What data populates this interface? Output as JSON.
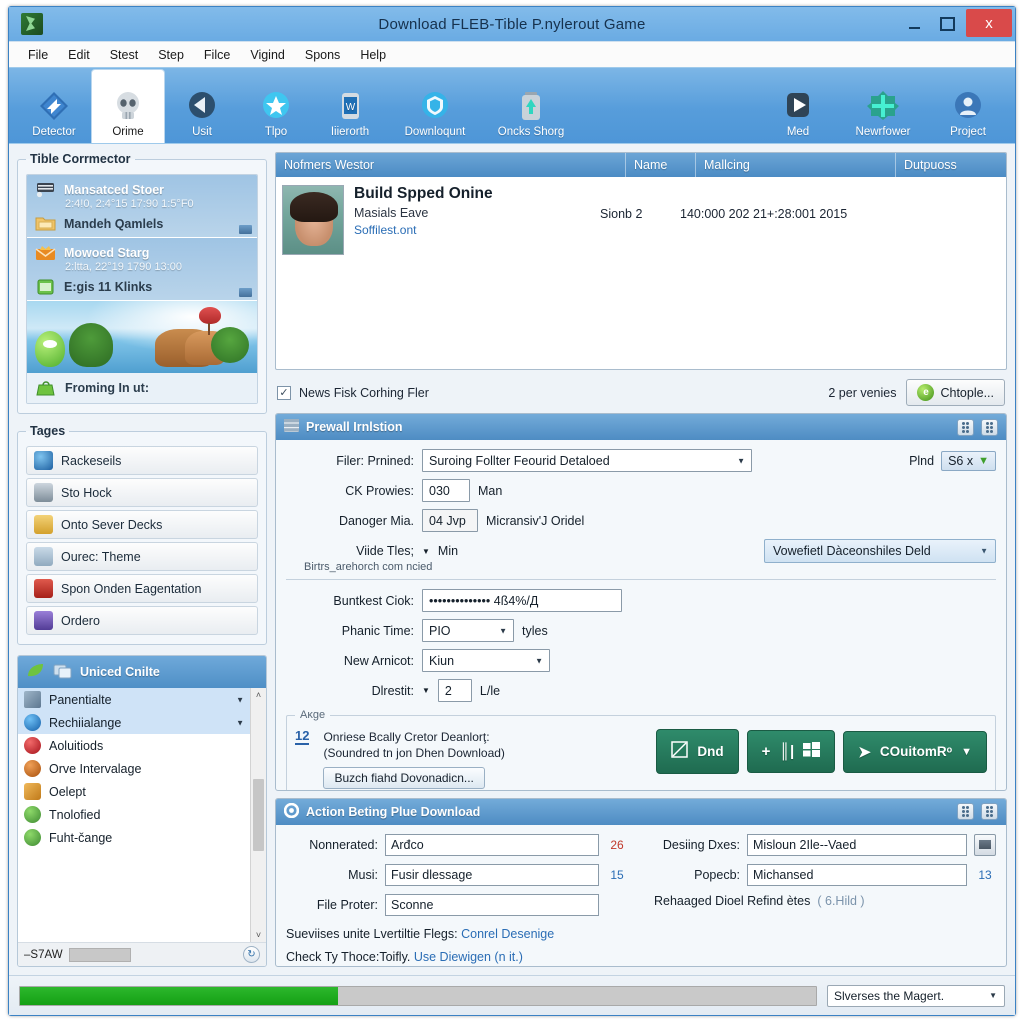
{
  "window": {
    "title": "Download FLEB-Tible P.nylerout Game",
    "icon": "app-icon",
    "controls": {
      "minimize": "–",
      "maximize": "□",
      "close": "x"
    }
  },
  "menubar": {
    "items": [
      "File",
      "Edit",
      "Stest",
      "Step",
      "Filce",
      "Vigind",
      "Spons",
      "Help"
    ]
  },
  "toolbar": {
    "items": [
      {
        "label": "Detector",
        "icon": "diamond-arrow-icon",
        "active": false
      },
      {
        "label": "Orime",
        "icon": "skull-icon",
        "active": true
      },
      {
        "label": "Usit",
        "icon": "back-arrow-icon",
        "active": false
      },
      {
        "label": "Tlpo",
        "icon": "star-circle-icon",
        "active": false
      },
      {
        "label": "Iiierorth",
        "icon": "phone-icon",
        "active": false
      },
      {
        "label": "Downloqunt",
        "icon": "shield-icon",
        "active": false
      },
      {
        "label": "Oncks Shorg",
        "icon": "battery-down-icon",
        "active": false
      }
    ],
    "right_items": [
      {
        "label": "Med",
        "icon": "play-icon"
      },
      {
        "label": "Newrfower",
        "icon": "plus-burst-icon"
      },
      {
        "label": "Project",
        "icon": "person-gear-icon"
      }
    ]
  },
  "sidebar": {
    "connector": {
      "legend": "Tible Corrmector",
      "rows": [
        {
          "title": "Mansatced Stoer",
          "sub": "2:4!0, 2:4°15 17:90 1:5°F0",
          "title2": "Mandeh Qamlels",
          "icon": "printer-icon",
          "icon2": "folder-icon"
        },
        {
          "title": "Mowoed Starg",
          "sub": "2:ltta, 22°19 1790 13:00",
          "title2": "E:gis 11 Klinks",
          "icon": "crown-mail-icon",
          "icon2": "green-note-icon"
        }
      ],
      "banner": "landscape-banner",
      "footer": {
        "label": "Froming In ut:",
        "icon": "green-bag-icon"
      }
    },
    "tags": {
      "legend": "Tages",
      "items": [
        {
          "label": "Rackeseils",
          "icon": "globe-icon",
          "color": "#2f7cc4"
        },
        {
          "label": "Sto Hock",
          "icon": "disk-icon",
          "color": "#7d8b99"
        },
        {
          "label": "Onto Sever Decks",
          "icon": "people-icon",
          "color": "#e0b03c"
        },
        {
          "label": "Ourec: Theme",
          "icon": "image-icon",
          "color": "#9bb4c7"
        },
        {
          "label": "Spon Onden Eagentation",
          "icon": "red-doc-icon",
          "color": "#c0302b"
        },
        {
          "label": "Ordero",
          "icon": "purple-doc-icon",
          "color": "#6b4fb0"
        }
      ]
    },
    "explorer": {
      "title": "Uniced Cnilte",
      "head_icons": [
        "leaf-icon",
        "window-icon"
      ],
      "items": [
        {
          "label": "Panentialte",
          "icon": "grid-icon",
          "color": "#6d8ba5",
          "selected": true
        },
        {
          "label": "Rechiialange",
          "icon": "plus-circle-icon",
          "color": "#1f7fd0",
          "selected": true
        },
        {
          "label": "Aoluitiods",
          "icon": "target-icon",
          "color": "#cf2430",
          "selected": false
        },
        {
          "label": "Orve Intervalage",
          "icon": "donut-icon",
          "color": "#cf6a18",
          "selected": false
        },
        {
          "label": "Oelept",
          "icon": "key-icon",
          "color": "#d98b2c",
          "selected": false
        },
        {
          "label": "Tnolofied",
          "icon": "gear-green-icon",
          "color": "#4a9a4a",
          "selected": false
        },
        {
          "label": "Fuht-čange",
          "icon": "gear-green-icon",
          "color": "#4a9a4a",
          "selected": false
        }
      ],
      "footer": {
        "label": "–S7AW",
        "refresh_icon": "refresh-icon"
      },
      "scroll": {
        "up": "˄",
        "down": "˅"
      }
    }
  },
  "grid": {
    "columns": [
      "Nofmers Westor",
      "Name",
      "Mallcing",
      "Dutpuoss"
    ],
    "rows": [
      {
        "thumb": "person-photo",
        "title": "Build Spped Onine",
        "sub": "Masials Eave",
        "link": "Soffilest.ont",
        "name": "Sionb 2",
        "mallcing": "140:000 202 21+:28:001 2015",
        "dutpuoss": ""
      }
    ],
    "footer": {
      "checkbox_label": "News Fisk Corhing Fler",
      "checkbox_checked": true,
      "count": "2",
      "count_suffix": "per venies",
      "button": "Chtople...",
      "button_icon": "green-orb-icon"
    }
  },
  "panel_firewall": {
    "title": "Prewall Irnlstion",
    "icon": "firewall-icon",
    "header_buttons": [
      "grip-button-1",
      "grip-button-2"
    ],
    "fields": {
      "filer_label": "Filer: Prnined:",
      "filer_value": "Suroing Follter Feourid Detaloed",
      "pind_label": "Plnd",
      "pind_value": "S6 x",
      "ck_label": "CK Prowies:",
      "ck_value": "030",
      "ck_suffix": "Man",
      "danger_label": "Danoger Mia.",
      "danger_value": "04 Jvp",
      "danger_suffix": "Micransiv'J Oridel",
      "viide_label": "Viide Tles;",
      "viide_value": "Min",
      "viide_note": "Birtrs_arehorch com ncied",
      "novel_select": "Vowefietl Dàceonshiles Deld",
      "bunt_label": "Buntkest Ciok:",
      "bunt_value": "••••••••••••••   4ß4%/Д",
      "phanic_label": "Phanic Time:",
      "phanic_value": "PIO",
      "phanic_suffix": "tyles",
      "amicot_label": "New Arnicot:",
      "amicot_value": "Kiun",
      "direstit_label": "Dlrestit:",
      "direstit_value": "2",
      "direstit_suffix": "L/le"
    },
    "area": {
      "legend": "Aĸge",
      "badge": "12",
      "text_line1": "Onriese Bcally Cretor Deanlorţ:",
      "text_line2": "(Soundred tn jon Dhen Download)",
      "button": "Buzch fiahd Dovonadicn...",
      "green_buttons": [
        {
          "label": "Dnd",
          "icon": "edit-doc-icon"
        },
        {
          "label": "",
          "icon": "plus-bars-grid-icon"
        },
        {
          "label": "COuitomRᵒ",
          "icon": "send-icon",
          "caret": "▼"
        }
      ]
    }
  },
  "panel_action": {
    "title": "Action Beting Plue Download",
    "icon": "gear-icon",
    "header_buttons": [
      "grip-button-1",
      "grip-button-2"
    ],
    "left_fields": [
      {
        "label": "Nonnerated:",
        "value": "Arđco",
        "count": "26",
        "count_color": "#c0392b"
      },
      {
        "label": "Musi:",
        "value": "Fusir dlessage",
        "count": "15",
        "count_color": "#2a6db5"
      },
      {
        "label": "File Proter:",
        "value": "Sconne",
        "count": "",
        "count_color": "#2a6db5"
      }
    ],
    "right_fields": [
      {
        "label": "Desiing Dxes:",
        "value": "Misloun 2Ile--Vaed",
        "count": "",
        "has_button": true
      },
      {
        "label": "Popecb:",
        "value": "Michansed",
        "count": "13",
        "has_button": false
      }
    ],
    "rehaaged_text": "Rehaaged Dioel Refind ètes",
    "rehaaged_link": "( 6.Hild )",
    "foot_line1_text": "Sueviises unite Lvertiltie Flegs:",
    "foot_line1_link": "Conrel Desenige",
    "foot_line2_text": "Check Ty Thoce:Toifly.",
    "foot_line2_link": "Use Diewigen (n it.)"
  },
  "statusbar": {
    "progress_percent": 40,
    "dropdown_value": "Slverses the Magert."
  },
  "colors": {
    "accent_blue": "#4e8cc3",
    "green_button": "#2f8b6b",
    "progress_green": "#14a014",
    "link_blue": "#2a6db5",
    "close_red": "#d94a4a"
  }
}
